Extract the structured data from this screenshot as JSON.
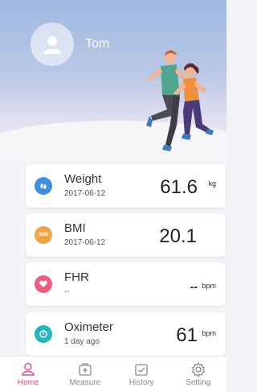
{
  "user": {
    "name": "Tom"
  },
  "cards": [
    {
      "title": "Weight",
      "subtitle": "2017-06-12",
      "value": "61.6",
      "unit": "kg",
      "icon": "footprint-icon",
      "color": "#3f8fe0"
    },
    {
      "title": "BMI",
      "subtitle": "2017-06-12",
      "value": "20.1",
      "unit": "",
      "icon": "bmi-icon",
      "icon_text": "BMI",
      "color": "#f1a443"
    },
    {
      "title": "FHR",
      "subtitle": "--",
      "value": "--",
      "unit": "bpm",
      "icon": "heart-icon",
      "color": "#ee5d7e"
    },
    {
      "title": "Oximeter",
      "subtitle": "1 day ago",
      "value": "61",
      "unit": "bpm",
      "icon": "oximeter-icon",
      "color": "#27b3c0"
    }
  ],
  "nav": [
    {
      "label": "Home",
      "icon": "user-icon",
      "active": true
    },
    {
      "label": "Measure",
      "icon": "measure-icon"
    },
    {
      "label": "History",
      "icon": "history-icon"
    },
    {
      "label": "Setting",
      "icon": "gear-icon"
    }
  ],
  "colors": {
    "accent": "#e94a86",
    "nav_inactive": "#8a8a8a"
  }
}
